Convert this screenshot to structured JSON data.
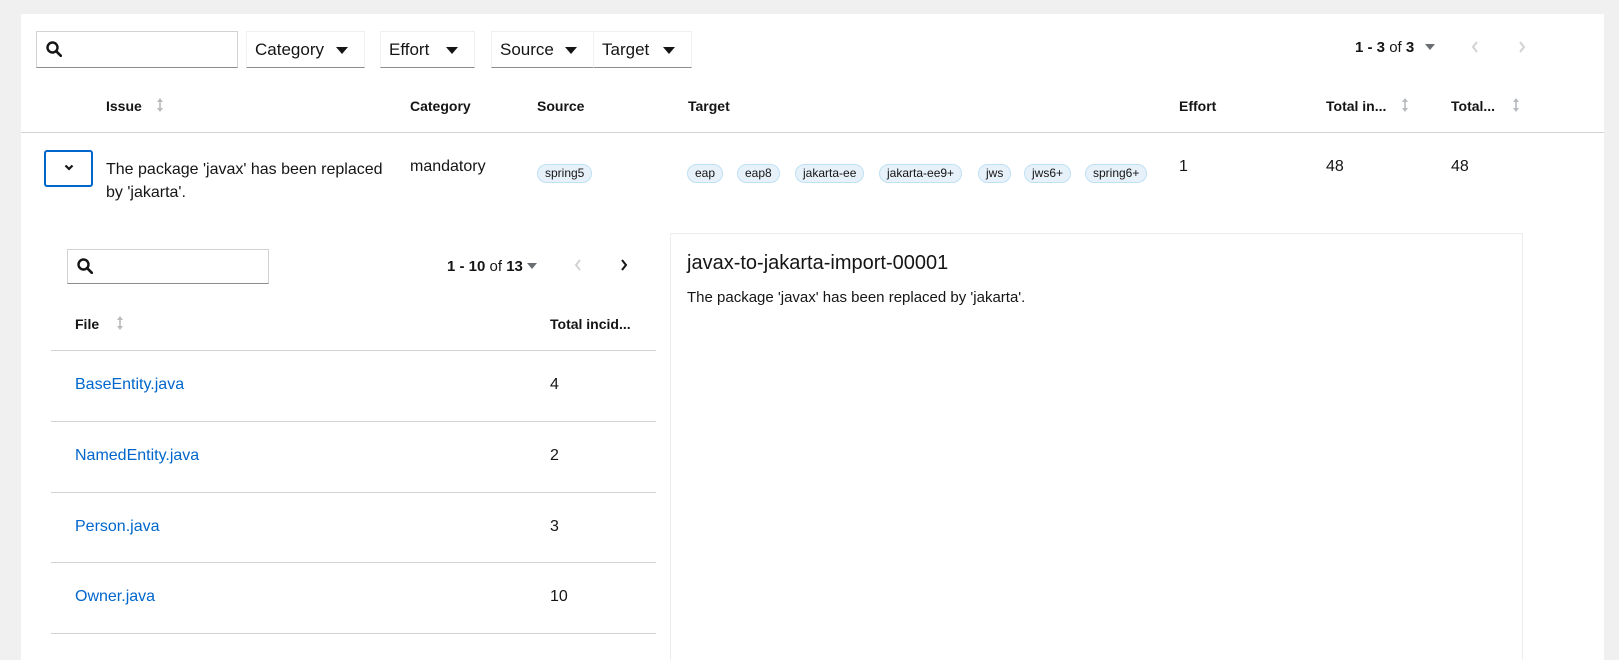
{
  "toolbar": {
    "search_placeholder": "",
    "filters": [
      "Category",
      "Effort",
      "Source",
      "Target"
    ],
    "pagination": {
      "range": "1 - 3",
      "of_label": "of",
      "total": "3"
    }
  },
  "table": {
    "columns": [
      "Issue",
      "Category",
      "Source",
      "Target",
      "Effort",
      "Total in...",
      "Total..."
    ],
    "row": {
      "issue_line1": "The package 'javax' has been replaced",
      "issue_line2": "by 'jakarta'.",
      "category": "mandatory",
      "source_labels": [
        "spring5"
      ],
      "target_labels": [
        "eap",
        "eap8",
        "jakarta-ee",
        "jakarta-ee9+",
        "jws",
        "jws6+",
        "spring6+"
      ],
      "effort": "1",
      "total_incidents": "48",
      "total_files": "48"
    }
  },
  "files": {
    "search_placeholder": "",
    "pagination": {
      "range": "1 - 10",
      "of_label": "of",
      "total": "13"
    },
    "columns": [
      "File",
      "Total incid..."
    ],
    "rows": [
      {
        "file": "BaseEntity.java",
        "incidents": "4"
      },
      {
        "file": "NamedEntity.java",
        "incidents": "2"
      },
      {
        "file": "Person.java",
        "incidents": "3"
      },
      {
        "file": "Owner.java",
        "incidents": "10"
      }
    ]
  },
  "detail": {
    "rule_id": "javax-to-jakarta-import-00001",
    "message": "The package 'javax' has been replaced by 'jakarta'."
  },
  "colors": {
    "link": "#0066cc",
    "label_bg": "#e7f1fa",
    "label_border": "#bee1f4",
    "background": "#f0f0f0"
  }
}
